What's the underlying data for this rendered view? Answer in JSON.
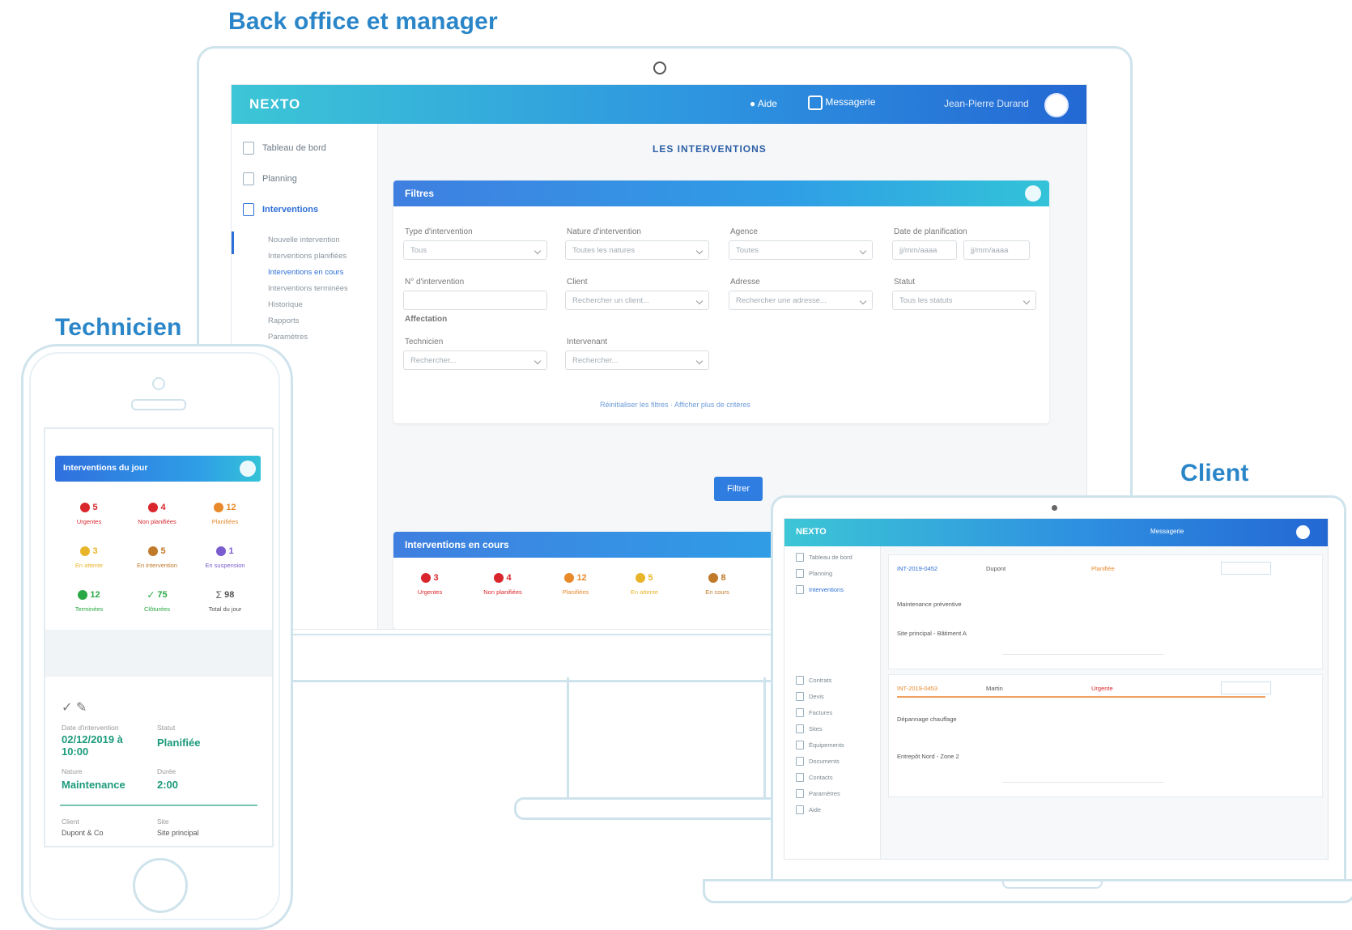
{
  "captions": {
    "backoffice": "Back office et manager",
    "technicien": "Technicien",
    "client": "Client"
  },
  "desktop": {
    "logo": "NEXTO",
    "topbar": {
      "item1": "Aide",
      "item2": "Messagerie",
      "user": "Jean-Pierre Durand"
    },
    "sidebar": {
      "items": [
        {
          "label": "Tableau de bord"
        },
        {
          "label": "Planning"
        },
        {
          "label": "Interventions"
        }
      ],
      "sub_items": [
        "Nouvelle intervention",
        "Interventions planifiées",
        "Interventions en cours",
        "Interventions terminées",
        "Historique",
        "Rapports",
        "Paramètres"
      ]
    },
    "page_title": "LES INTERVENTIONS",
    "filter_card": {
      "title": "Filtres",
      "fields": [
        {
          "label": "Type d'intervention",
          "value": "Tous"
        },
        {
          "label": "Nature d'intervention",
          "value": "Toutes les natures"
        },
        {
          "label": "Agence",
          "value": "Toutes"
        },
        {
          "label": "Date de planification",
          "value": "jj/mm/aaaa"
        },
        {
          "label": "N° d'intervention",
          "value": ""
        },
        {
          "label": "Client",
          "value": "Rechercher un client..."
        },
        {
          "label": "Adresse",
          "value": "Rechercher une adresse..."
        },
        {
          "label": "Technicien",
          "value": "Rechercher..."
        },
        {
          "label": "Intervenant",
          "value": "Rechercher..."
        },
        {
          "label": "Statut",
          "value": "Tous les statuts"
        }
      ],
      "section_label": "Affectation",
      "link": "Réinitialiser les filtres · Afficher plus de critères"
    },
    "search_button": "Filtrer",
    "interventions_card": {
      "title": "Interventions en cours",
      "stats": [
        {
          "num": "3",
          "label": "Urgentes",
          "color": "#d9262c"
        },
        {
          "num": "4",
          "label": "Non planifiées",
          "color": "#d9262c"
        },
        {
          "num": "12",
          "label": "Planifiées",
          "color": "#e8892a"
        },
        {
          "num": "5",
          "label": "En attente",
          "color": "#e8b52a"
        },
        {
          "num": "8",
          "label": "En cours",
          "color": "#c07a2a"
        }
      ]
    }
  },
  "phone": {
    "card_title": "Interventions du jour",
    "stats": [
      {
        "num": "5",
        "label": "Urgentes",
        "color": "#d9262c"
      },
      {
        "num": "4",
        "label": "Non planifiées",
        "color": "#d9262c"
      },
      {
        "num": "12",
        "label": "Planifiées",
        "color": "#e8892a"
      },
      {
        "num": "3",
        "label": "En attente",
        "color": "#e8b52a"
      },
      {
        "num": "5",
        "label": "En intervention",
        "color": "#c07a2a"
      },
      {
        "num": "1",
        "label": "En suspension",
        "color": "#7a5ccf"
      },
      {
        "num": "12",
        "label": "Terminées",
        "color": "#2aa845"
      },
      {
        "num": "75",
        "label": "Clôturées",
        "color": "#2aa845"
      },
      {
        "num": "98",
        "label": "Total du jour",
        "color": "#555555"
      }
    ],
    "detail": {
      "f1_label": "Date d'intervention",
      "f1_value": "02/12/2019 à 10:00",
      "f2_label": "Statut",
      "f2_value": "Planifiée",
      "f3_label": "Nature",
      "f3_value": "Maintenance",
      "f4_label": "Durée",
      "f4_value": "2:00",
      "f5_label": "Client",
      "f5_value": "Dupont & Co",
      "f6_label": "Site",
      "f6_value": "Site principal"
    }
  },
  "laptop": {
    "logo": "NEXTO",
    "topbar_item": "Messagerie",
    "sidebar": [
      "Tableau de bord",
      "Planning",
      "Interventions",
      "Contrats",
      "Devis",
      "Factures",
      "Sites",
      "Équipements",
      "Documents",
      "Contacts",
      "Paramètres",
      "Aide"
    ],
    "rows": [
      {
        "ref": "INT-2019-0452",
        "client": "Dupont",
        "status": "Planifiée",
        "line1": "Maintenance préventive",
        "line2": "Site principal - Bâtiment A"
      },
      {
        "ref": "INT-2019-0453",
        "client": "Martin",
        "status": "Urgente",
        "line1": "Dépannage chauffage",
        "line2": "Entrepôt Nord - Zone 2"
      }
    ]
  }
}
